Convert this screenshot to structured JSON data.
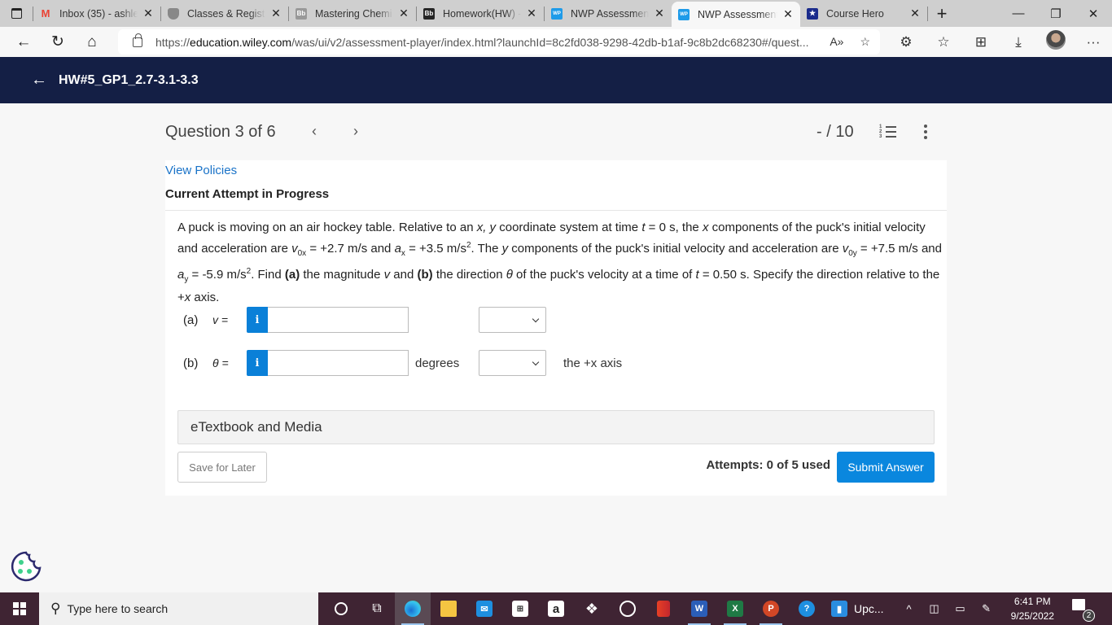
{
  "browser": {
    "tabs": [
      {
        "label": "Inbox (35) - ashle",
        "icon": "gmail-icon",
        "favicon_text": "M",
        "color": "#ea4335"
      },
      {
        "label": "Classes & Registr",
        "icon": "shield-crest-icon",
        "favicon_text": "",
        "color": "#888888"
      },
      {
        "label": "Mastering Chemi",
        "icon": "blackboard-icon",
        "favicon_text": "Bb",
        "color": "#999999"
      },
      {
        "label": "Homework(HW) -",
        "icon": "blackboard-icon",
        "favicon_text": "Bb",
        "color": "#262626"
      },
      {
        "label": "NWP Assessment",
        "icon": "wileyplus-icon",
        "favicon_text": "WP",
        "color": "#1e9be9"
      },
      {
        "label": "NWP Assessment",
        "icon": "wileyplus-icon",
        "favicon_text": "WP",
        "color": "#1e9be9",
        "active": true
      },
      {
        "label": "Course Hero",
        "icon": "course-hero-icon",
        "favicon_text": "★",
        "color": "#1a2b8c"
      }
    ],
    "close_glyph": "✕",
    "new_tab_glyph": "+",
    "url": {
      "scheme": "https://",
      "host": "education.wiley.com",
      "path": "/was/ui/v2/assessment-player/index.html?launchId=8c2fd038-9298-42db-b1af-9c8b2dc68230#/quest..."
    }
  },
  "header": {
    "back_glyph": "←",
    "title": "HW#5_GP1_2.7-3.1-3.3"
  },
  "question_nav": {
    "title": "Question 3 of 6",
    "prev_glyph": "‹",
    "next_glyph": "›",
    "score": "- / 10"
  },
  "content": {
    "view_policies": "View Policies",
    "attempt_status": "Current Attempt in Progress",
    "problem": {
      "p1": "A puck is moving on an air hockey table. Relative to an ",
      "p1_xy": "x, y",
      "p1b": " coordinate system at time ",
      "t": "t",
      "p1c": " = 0 s, the ",
      "x": "x",
      "p1d": " components of the puck's initial velocity and acceleration are ",
      "v0x_sym": "v",
      "v0x_sub": "0x",
      "v0x_val": " = +2.7 m/s and ",
      "ax_sym": "a",
      "ax_sub": "x",
      "ax_val": " = +3.5 m/s",
      "sq": "2",
      "p2": ". The ",
      "y": "y",
      "p2b": " components of the puck's initial velocity and acceleration are ",
      "v0y_sym": "v",
      "v0y_sub": "0y",
      "v0y_val": " = +7.5 m/s and ",
      "ay_sym": "a",
      "ay_sub": "y",
      "ay_val": " = -5.9 m/s",
      "p3": ". Find ",
      "a_label": "(a)",
      "p3b": " the magnitude ",
      "v": "v",
      "p3c": " and ",
      "b_label": "(b)",
      "p3d": " the direction ",
      "theta": "θ",
      "p3e": " of the puck's velocity at a time of ",
      "t2": "t",
      "p3f": " = 0.50 s. Specify the direction relative to the +",
      "x2": "x",
      "p3g": " axis."
    },
    "answers": [
      {
        "part": "(a)",
        "variable": "v =",
        "info_glyph": "i",
        "value": "",
        "unit_text": "",
        "unit_select": "",
        "suffix": ""
      },
      {
        "part": "(b)",
        "variable": "θ =",
        "info_glyph": "i",
        "value": "",
        "unit_text": "degrees",
        "unit_select": "",
        "suffix": "the +x axis"
      }
    ],
    "etextbook": "eTextbook and Media",
    "save_for_later": "Save for Later",
    "attempts": "Attempts: 0 of 5 used",
    "submit": "Submit Answer"
  },
  "taskbar": {
    "search_placeholder": "Type here to search",
    "pinned_label": "Upc...",
    "time": "6:41 PM",
    "date": "9/25/2022",
    "notification_count": "2"
  }
}
